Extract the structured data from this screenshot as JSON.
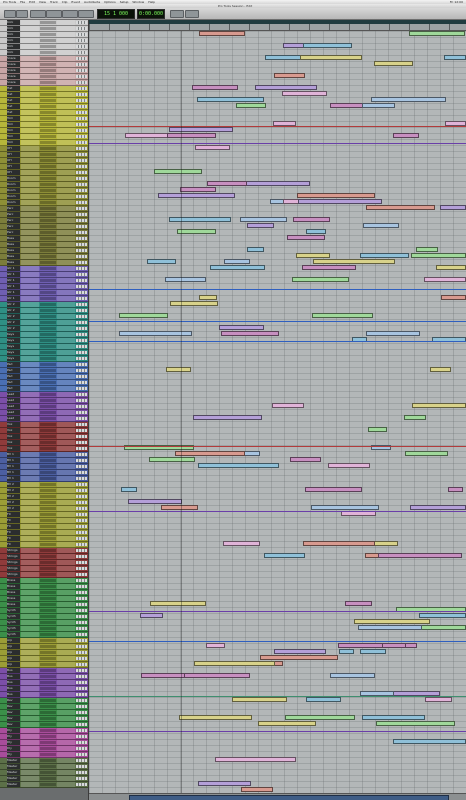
{
  "window": {
    "title": "Pro Tools Session - Edit"
  },
  "menubar": {
    "items": [
      "Pro Tools",
      "File",
      "Edit",
      "View",
      "Track",
      "Clip",
      "Event",
      "AudioSuite",
      "Options",
      "Setup",
      "Window",
      "Help"
    ],
    "clock": "Fri 12:00"
  },
  "toolbar": {
    "main_counter": "15 1 000",
    "sub_counter": "0:00.000"
  },
  "colors": {
    "accent": "#7dfc5c",
    "timeline": "#b3b7b8"
  },
  "tracks": [
    {
      "name": "Kick",
      "color": "#c9c9c9"
    },
    {
      "name": "Snare",
      "color": "#c8a6a6"
    },
    {
      "name": "Hat",
      "color": "#b6b63a"
    },
    {
      "name": "Tom",
      "color": "#b6b63a"
    },
    {
      "name": "OH",
      "color": "#8e8f36"
    },
    {
      "name": "Room",
      "color": "#8e8f36"
    },
    {
      "name": "Perc",
      "color": "#7c7d3b"
    },
    {
      "name": "Bass",
      "color": "#7c7d3b"
    },
    {
      "name": "Gtr 1",
      "color": "#6f5fb2"
    },
    {
      "name": "Gtr 2",
      "color": "#2f8f84"
    },
    {
      "name": "Keys",
      "color": "#2f8f84"
    },
    {
      "name": "Pad",
      "color": "#4a6fb3"
    },
    {
      "name": "Lead",
      "color": "#7b4fa8"
    },
    {
      "name": "Vox",
      "color": "#8f3b3b"
    },
    {
      "name": "BV 1",
      "color": "#4c5fa1"
    },
    {
      "name": "BV 2",
      "color": "#9b9d36"
    },
    {
      "name": "FX",
      "color": "#9b9d36"
    },
    {
      "name": "Strings",
      "color": "#8f3b3b"
    },
    {
      "name": "Brass",
      "color": "#3b8f49"
    },
    {
      "name": "Synth",
      "color": "#3b8f49"
    },
    {
      "name": "Arp",
      "color": "#9b9d36"
    },
    {
      "name": "Bus",
      "color": "#7b4fa8"
    },
    {
      "name": "Rev",
      "color": "#3b8f49"
    },
    {
      "name": "Dly",
      "color": "#a84d9b"
    },
    {
      "name": "Master",
      "color": "#5c7048"
    }
  ]
}
